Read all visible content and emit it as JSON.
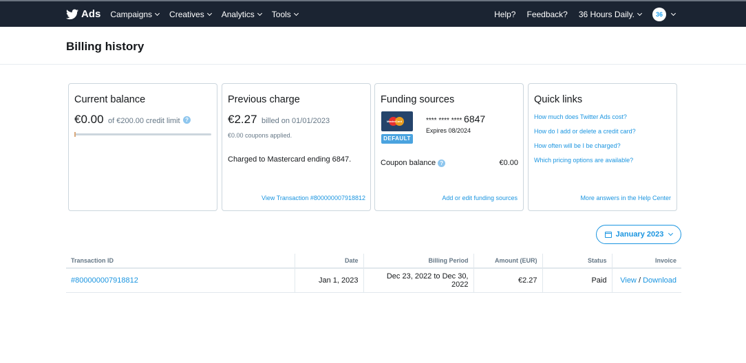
{
  "nav": {
    "brand": "Ads",
    "menus": [
      "Campaigns",
      "Creatives",
      "Analytics",
      "Tools"
    ],
    "help": "Help?",
    "feedback": "Feedback?",
    "account": "36 Hours Daily.",
    "avatar_text": "36"
  },
  "page": {
    "title": "Billing history"
  },
  "current_balance": {
    "title": "Current balance",
    "amount": "€0.00",
    "limit_text": "of €200.00 credit limit",
    "help_glyph": "?",
    "used_fraction": 0.0
  },
  "previous_charge": {
    "title": "Previous charge",
    "amount": "€2.27",
    "billed_text": "billed on 01/01/2023",
    "coupons": "€0.00 coupons applied.",
    "charged_to": "Charged to Mastercard ending 6847.",
    "view_link": "View Transaction #800000007918812"
  },
  "funding_sources": {
    "title": "Funding sources",
    "card_brand": "MasterCard",
    "badge": "DEFAULT",
    "card_mask": "**** **** ****",
    "card_last4": "6847",
    "expires": "Expires 08/2024",
    "coupon_label": "Coupon balance",
    "help_glyph": "?",
    "coupon_value": "€0.00",
    "edit_link": "Add or edit funding sources"
  },
  "quick_links": {
    "title": "Quick links",
    "links": [
      "How much does Twitter Ads cost?",
      "How do I add or delete a credit card?",
      "How often will be I be charged?",
      "Which pricing options are available?"
    ],
    "more": "More answers in the Help Center"
  },
  "month_selector": {
    "label": "January 2023",
    "icon": "calendar-icon"
  },
  "table": {
    "headers": [
      "Transaction ID",
      "Date",
      "Billing Period",
      "Amount (EUR)",
      "Status",
      "Invoice"
    ],
    "rows": [
      {
        "id": "#800000007918812",
        "date": "Jan 1, 2023",
        "period": "Dec 23, 2022 to Dec 30, 2022",
        "amount": "€2.27",
        "status": "Paid",
        "view": "View",
        "sep": "/",
        "download": "Download"
      }
    ]
  },
  "colors": {
    "nav_bg": "#1b2432",
    "link": "#1b95e0",
    "badge": "#4aa3df",
    "text": "#14171a",
    "muted": "#657786"
  }
}
